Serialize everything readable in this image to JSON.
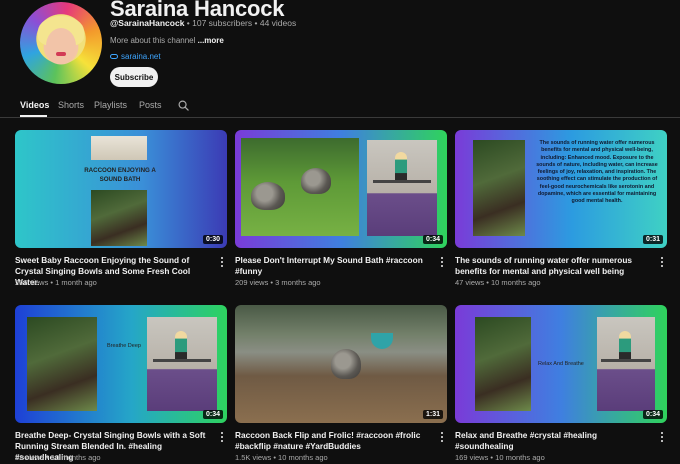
{
  "channel": {
    "name": "Saraina Hancock",
    "handle": "@SarainaHancock",
    "stats": " • 107 subscribers • 44 videos",
    "about": "More about this channel",
    "about_more": "...more",
    "link": "saraina.net",
    "subscribe_label": "Subscribe"
  },
  "tabs": [
    {
      "label": "Videos"
    },
    {
      "label": "Shorts"
    },
    {
      "label": "Playlists"
    },
    {
      "label": "Posts"
    }
  ],
  "videos": [
    {
      "title": "Sweet Baby Raccoon Enjoying the Sound of Crystal Singing Bowls and Some Fresh Cool Water.",
      "meta": "266 views • 1 month ago",
      "duration": "0:30",
      "thumb_caption": "RACCOON ENJOYING A SOUND BATH"
    },
    {
      "title": "Please Don't Interrupt My Sound Bath #raccoon #funny",
      "meta": "209 views • 3 months ago",
      "duration": "0:34"
    },
    {
      "title": "The sounds of running water offer numerous benefits for mental and physical well being",
      "meta": "47 views • 10 months ago",
      "duration": "0:31",
      "thumb_text": "The sounds of running water offer numerous benefits for mental and physical well-being, including: Enhanced mood. Exposure to the sounds of nature, including water, can increase feelings of joy, relaxation, and inspiration. The soothing effect can stimulate the production of feel-good neurochemicals like serotonin and dopamine, which are essential for maintaining good mental health."
    },
    {
      "title": "Breathe Deep- Crystal Singing Bowls with a Soft Running Stream Blended In. #healing #soundhealing",
      "meta": "52 views • 10 months ago",
      "duration": "0:34",
      "thumb_label": "Breathe Deep"
    },
    {
      "title": "Raccoon Back Flip and Frolic!  #raccoon #frolic #backflip #nature #YardBuddies",
      "meta": "1.5K views • 10 months ago",
      "duration": "1:31"
    },
    {
      "title": "Relax and Breathe #crystal #healing #soundhealing",
      "meta": "169 views • 10 months ago",
      "duration": "0:34",
      "thumb_label": "Relax And Breathe"
    }
  ],
  "colors": {
    "background": "#0f0f0f",
    "link": "#3ea6ff",
    "text_secondary": "#aaaaaa"
  }
}
